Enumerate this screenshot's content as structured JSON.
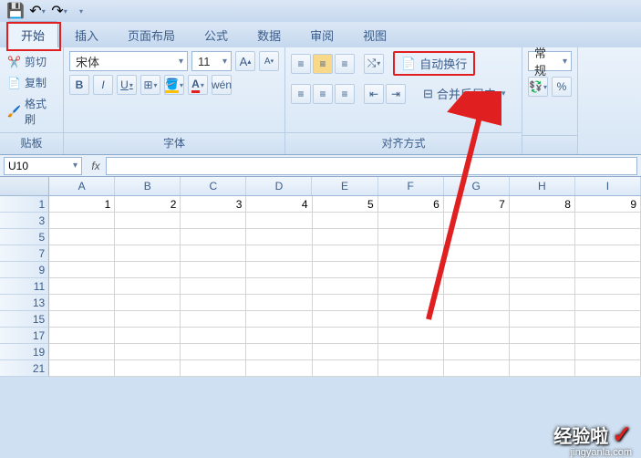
{
  "qat": {
    "save": "save",
    "undo": "undo",
    "redo": "redo"
  },
  "tabs": {
    "start": "开始",
    "insert": "插入",
    "layout": "页面布局",
    "formula": "公式",
    "data": "数据",
    "review": "审阅",
    "view": "视图"
  },
  "clipboard": {
    "cut": "剪切",
    "copy": "复制",
    "format": "格式刷",
    "label": "贴板"
  },
  "font": {
    "name": "宋体",
    "size": "11",
    "label": "字体",
    "bold": "B",
    "italic": "I",
    "underline": "U"
  },
  "align": {
    "wrap": "自动换行",
    "merge": "合并后居中",
    "label": "对齐方式"
  },
  "number": {
    "general": "常规",
    "percent": "%"
  },
  "namebox": "U10",
  "columns": [
    "A",
    "B",
    "C",
    "D",
    "E",
    "F",
    "G",
    "H",
    "I"
  ],
  "rows": [
    {
      "h": "1",
      "cells": [
        "1",
        "2",
        "3",
        "4",
        "5",
        "6",
        "7",
        "8",
        "9"
      ]
    },
    {
      "h": "3",
      "cells": [
        "",
        "",
        "",
        "",
        "",
        "",
        "",
        "",
        ""
      ]
    },
    {
      "h": "5",
      "cells": [
        "",
        "",
        "",
        "",
        "",
        "",
        "",
        "",
        ""
      ]
    },
    {
      "h": "7",
      "cells": [
        "",
        "",
        "",
        "",
        "",
        "",
        "",
        "",
        ""
      ]
    },
    {
      "h": "9",
      "cells": [
        "",
        "",
        "",
        "",
        "",
        "",
        "",
        "",
        ""
      ]
    },
    {
      "h": "11",
      "cells": [
        "",
        "",
        "",
        "",
        "",
        "",
        "",
        "",
        ""
      ]
    },
    {
      "h": "13",
      "cells": [
        "",
        "",
        "",
        "",
        "",
        "",
        "",
        "",
        ""
      ]
    },
    {
      "h": "15",
      "cells": [
        "",
        "",
        "",
        "",
        "",
        "",
        "",
        "",
        ""
      ]
    },
    {
      "h": "17",
      "cells": [
        "",
        "",
        "",
        "",
        "",
        "",
        "",
        "",
        ""
      ]
    },
    {
      "h": "19",
      "cells": [
        "",
        "",
        "",
        "",
        "",
        "",
        "",
        "",
        ""
      ]
    },
    {
      "h": "21",
      "cells": [
        "",
        "",
        "",
        "",
        "",
        "",
        "",
        "",
        ""
      ]
    }
  ],
  "watermark": {
    "text": "经验啦",
    "sub": "jingyanla.com",
    "check": "✓"
  }
}
